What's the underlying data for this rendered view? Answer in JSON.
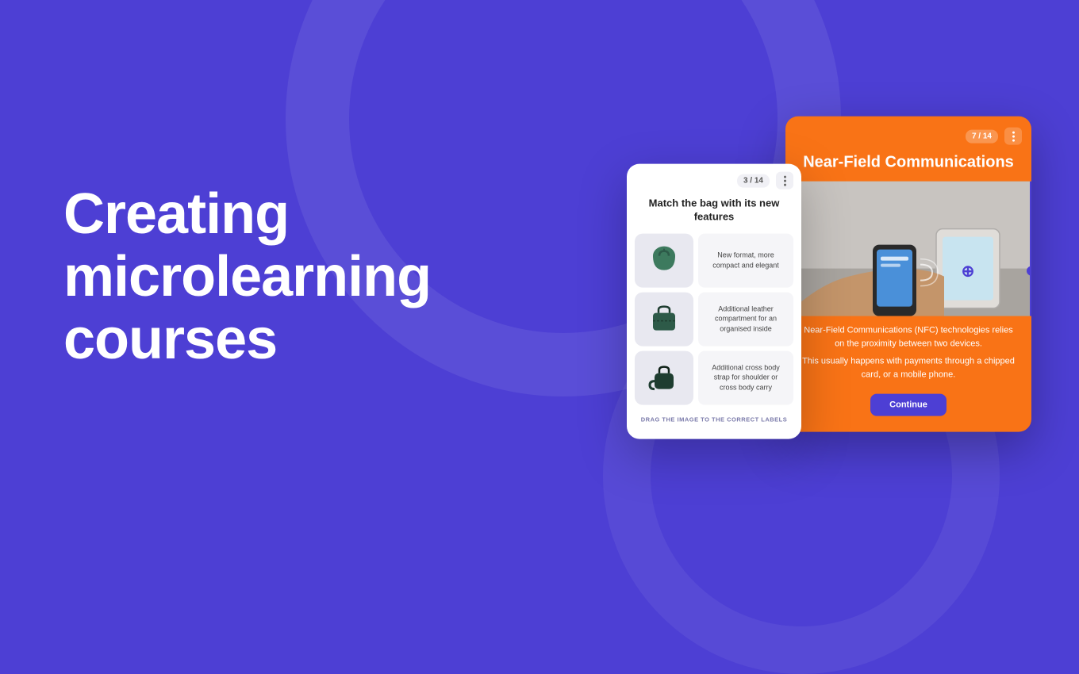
{
  "background": {
    "color": "#4d3fd4"
  },
  "hero": {
    "line1": "Creating",
    "line2": "microlearning",
    "line3": "courses"
  },
  "card_white": {
    "badge": "3 / 14",
    "title": "Match the bag with its new features",
    "rows": [
      {
        "label": "New format, more compact and elegant",
        "bag_color": "#3d7a5e"
      },
      {
        "label": "Additional leather compartment for an organised inside",
        "bag_color": "#2d5a48"
      },
      {
        "label": "Additional cross body strap for shoulder or cross body carry",
        "bag_color": "#1e3d30"
      }
    ],
    "drag_hint": "DRAG THE IMAGE TO THE CORRECT LABELS"
  },
  "card_orange": {
    "badge": "7 / 14",
    "title": "Near-Field Communications",
    "body_text_1": "Near-Field Communications (NFC) technologies relies on the proximity between two devices.",
    "body_text_2": "This usually happens with payments through a chipped card, or a mobile phone.",
    "continue_label": "Continue",
    "bg_color": "#f97316"
  }
}
